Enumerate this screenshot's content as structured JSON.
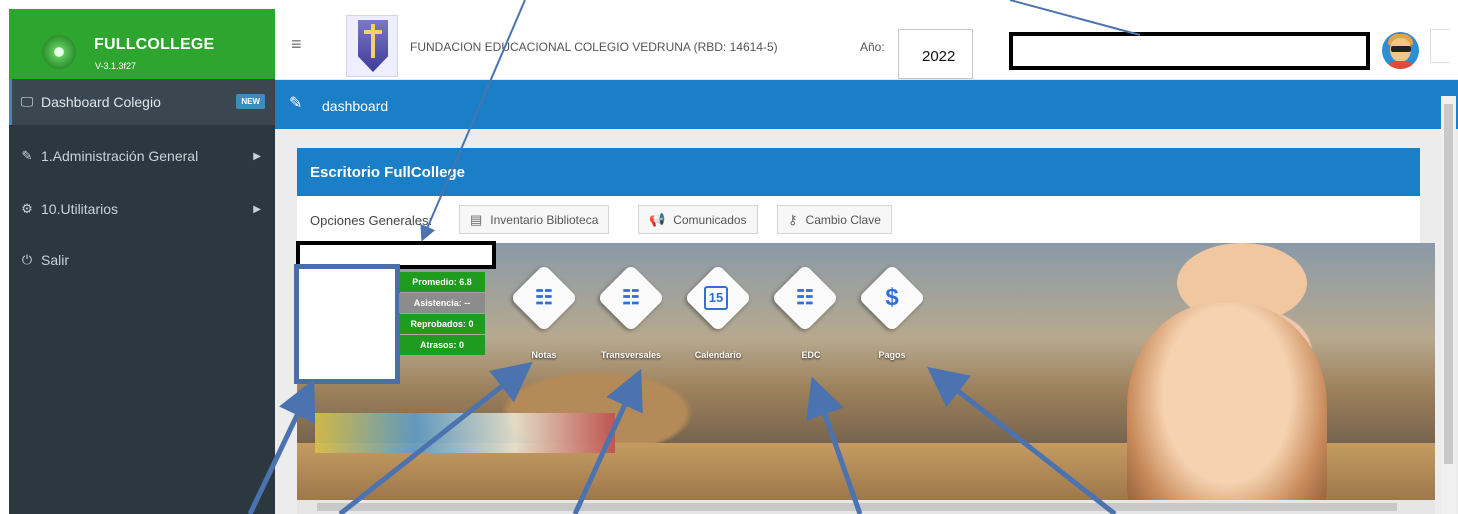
{
  "app": {
    "title": "FULLCOLLEGE",
    "version": "V-3.1.3f27",
    "brand_color": "#2ea52f",
    "accent_color": "#1a7fc7"
  },
  "sidebar": {
    "items": [
      {
        "label": "Dashboard Colegio",
        "icon": "monitor-icon",
        "badge": "NEW"
      },
      {
        "label": "1.Administración General",
        "icon": "edit-icon"
      },
      {
        "label": "10.Utilitarios",
        "icon": "gear-icon"
      },
      {
        "label": "Salir",
        "icon": "power-icon"
      }
    ]
  },
  "header": {
    "school": "FUNDACION EDUCACIONAL COLEGIO VEDRUNA (RBD: 14614-5)",
    "year_label": "Año:",
    "year_value": "2022"
  },
  "breadcrumb": {
    "label": "dashboard"
  },
  "panel": {
    "title": "Escritorio FullCollege",
    "options_label": "Opciones Generales:",
    "options": [
      {
        "label": "Inventario Biblioteca",
        "icon": "book-icon"
      },
      {
        "label": "Comunicados",
        "icon": "megaphone-icon"
      },
      {
        "label": "Cambio Clave",
        "icon": "key-icon"
      }
    ]
  },
  "student_stats": [
    {
      "label": "Promedio: 6.8",
      "status": "green"
    },
    {
      "label": "Asistencia: --",
      "status": "gray"
    },
    {
      "label": "Reprobados: 0",
      "status": "green"
    },
    {
      "label": "Atrasos: 0",
      "status": "green"
    }
  ],
  "tiles": [
    {
      "label": "Notas",
      "icon": "clipboard-icon"
    },
    {
      "label": "Transversales",
      "icon": "clipboard-icon"
    },
    {
      "label": "Calendario",
      "icon": "calendar-icon",
      "glyph": "15"
    },
    {
      "label": "EDC",
      "icon": "clipboard-icon"
    },
    {
      "label": "Pagos",
      "icon": "dollar-icon",
      "glyph": "$"
    }
  ]
}
